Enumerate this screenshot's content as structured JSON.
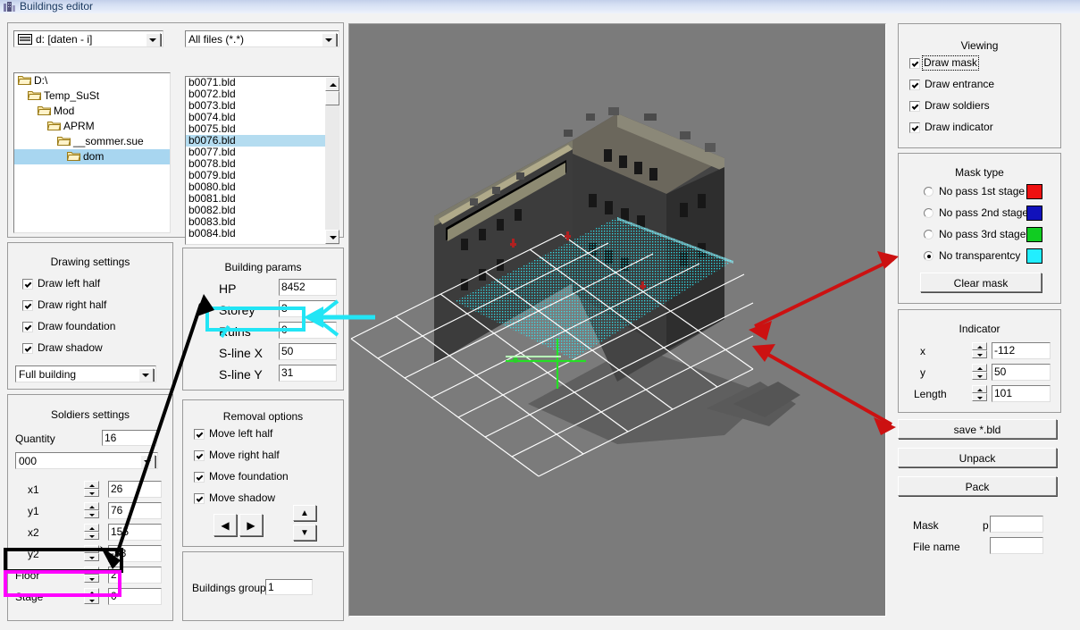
{
  "window": {
    "title": "Buildings editor",
    "icon": "building-icon"
  },
  "file_browser": {
    "drive_combo": {
      "value": "d: [daten - i]",
      "icon": "drive-icon"
    },
    "filter_combo": {
      "value": "All files (*.*)"
    },
    "tree": [
      {
        "label": "D:\\",
        "depth": 0,
        "selected": false
      },
      {
        "label": "Temp_SuSt",
        "depth": 1,
        "selected": false
      },
      {
        "label": "Mod",
        "depth": 2,
        "selected": false
      },
      {
        "label": "APRM",
        "depth": 3,
        "selected": false
      },
      {
        "label": "__sommer.sue",
        "depth": 4,
        "selected": false
      },
      {
        "label": "dom",
        "depth": 5,
        "selected": true
      }
    ],
    "files": [
      {
        "name": "b0071.bld",
        "selected": false
      },
      {
        "name": "b0072.bld",
        "selected": false
      },
      {
        "name": "b0073.bld",
        "selected": false
      },
      {
        "name": "b0074.bld",
        "selected": false
      },
      {
        "name": "b0075.bld",
        "selected": false
      },
      {
        "name": "b0076.bld",
        "selected": true
      },
      {
        "name": "b0077.bld",
        "selected": false
      },
      {
        "name": "b0078.bld",
        "selected": false
      },
      {
        "name": "b0079.bld",
        "selected": false
      },
      {
        "name": "b0080.bld",
        "selected": false
      },
      {
        "name": "b0081.bld",
        "selected": false
      },
      {
        "name": "b0082.bld",
        "selected": false
      },
      {
        "name": "b0083.bld",
        "selected": false
      },
      {
        "name": "b0084.bld",
        "selected": false
      }
    ]
  },
  "drawing_settings": {
    "title": "Drawing settings",
    "checks": [
      {
        "label": "Draw left half",
        "checked": true
      },
      {
        "label": "Draw right half",
        "checked": true
      },
      {
        "label": "Draw foundation",
        "checked": true
      },
      {
        "label": "Draw shadow",
        "checked": true
      }
    ],
    "mode_combo": {
      "value": "Full building"
    }
  },
  "soldiers_settings": {
    "title": "Soldiers settings",
    "quantity_label": "Quantity",
    "quantity_value": "16",
    "group_combo": {
      "value": "000"
    },
    "fields": [
      {
        "label": "x1",
        "value": "26"
      },
      {
        "label": "y1",
        "value": "76"
      },
      {
        "label": "x2",
        "value": "155"
      },
      {
        "label": "y2",
        "value": "-53"
      },
      {
        "label": "Floor",
        "value": "2"
      },
      {
        "label": "Stage",
        "value": "0"
      }
    ]
  },
  "building_params": {
    "title": "Building params",
    "fields": [
      {
        "label": "HP",
        "value": "8452"
      },
      {
        "label": "Storey",
        "value": "3"
      },
      {
        "label": "Ruins",
        "value": "0"
      },
      {
        "label": "S-line X",
        "value": "50"
      },
      {
        "label": "S-line Y",
        "value": "31"
      }
    ]
  },
  "removal_options": {
    "title": "Removal options",
    "checks": [
      {
        "label": "Move left half",
        "checked": true
      },
      {
        "label": "Move right half",
        "checked": true
      },
      {
        "label": "Move foundation",
        "checked": true
      },
      {
        "label": "Move shadow",
        "checked": true
      }
    ],
    "nav_buttons": [
      {
        "icon": "arrow-left-icon"
      },
      {
        "icon": "arrow-right-icon"
      },
      {
        "icon": "arrow-up-icon"
      },
      {
        "icon": "arrow-down-icon"
      }
    ]
  },
  "buildings_group": {
    "label": "Buildings group",
    "value": "1"
  },
  "viewing": {
    "title": "Viewing",
    "checks": [
      {
        "label": "Draw mask",
        "checked": true,
        "focused": true
      },
      {
        "label": "Draw entrance",
        "checked": true,
        "focused": false
      },
      {
        "label": "Draw soldiers",
        "checked": true,
        "focused": false
      },
      {
        "label": "Draw indicator",
        "checked": true,
        "focused": false
      }
    ]
  },
  "mask_type": {
    "title": "Mask type",
    "options": [
      {
        "label": "No pass 1st stage",
        "selected": false,
        "color": "#ee1111"
      },
      {
        "label": "No pass 2nd stage",
        "selected": false,
        "color": "#1111bb"
      },
      {
        "label": "No pass 3rd stage",
        "selected": false,
        "color": "#11cc22"
      },
      {
        "label": "No transparentcy",
        "selected": true,
        "color": "#22eeff"
      }
    ],
    "clear_button": "Clear mask"
  },
  "indicator": {
    "title": "Indicator",
    "fields": [
      {
        "label": "x",
        "value": "-112"
      },
      {
        "label": "y",
        "value": "50"
      },
      {
        "label": "Length",
        "value": "101"
      }
    ]
  },
  "actions": {
    "save": "save *.bld",
    "unpack": "Unpack",
    "pack": "Pack"
  },
  "file_info": {
    "mask_label": "Mask",
    "mask_prefix": "p",
    "mask_value": "",
    "filename_label": "File name",
    "filename_value": ""
  },
  "annotations": {
    "highlight_ruins_color": "#22e5f5",
    "highlight_floor_color": "#000000",
    "highlight_stage_color": "#ff00ff",
    "arrow_color": "#cc1111",
    "viewport_bg": "#7b7b7b"
  }
}
